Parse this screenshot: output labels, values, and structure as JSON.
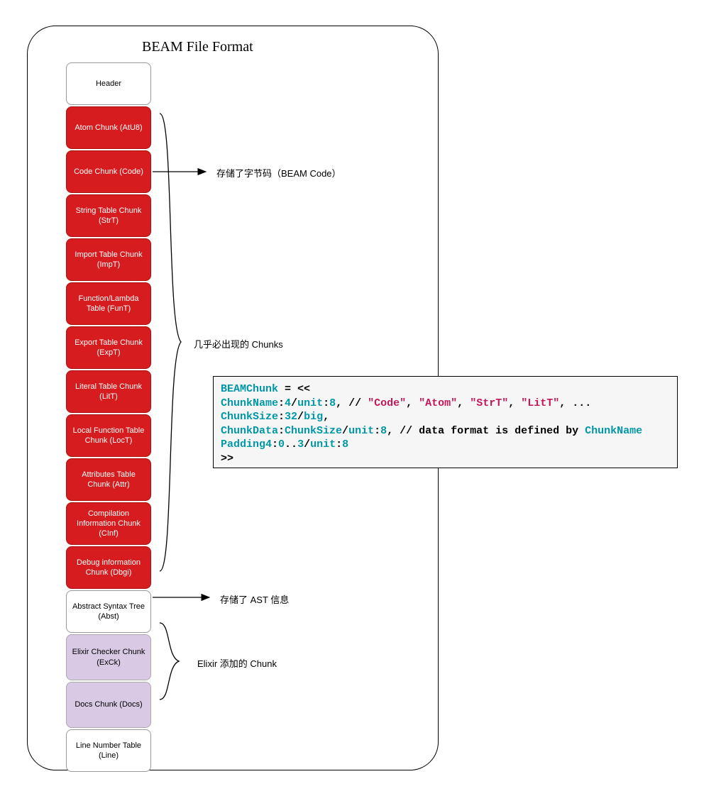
{
  "title": "BEAM File Format",
  "chunks": [
    {
      "label": "Header",
      "style": "white"
    },
    {
      "label": "Atom Chunk (AtU8)",
      "style": "red"
    },
    {
      "label": "Code Chunk (Code)",
      "style": "red"
    },
    {
      "label": "String Table Chunk (StrT)",
      "style": "red"
    },
    {
      "label": "Import Table Chunk (ImpT)",
      "style": "red"
    },
    {
      "label": "Function/Lambda Table (FunT)",
      "style": "red"
    },
    {
      "label": "Export Table Chunk (ExpT)",
      "style": "red"
    },
    {
      "label": "Literal Table Chunk (LitT)",
      "style": "red"
    },
    {
      "label": "Local Function Table Chunk (LocT)",
      "style": "red"
    },
    {
      "label": "Attributes Table Chunk (Attr)",
      "style": "red"
    },
    {
      "label": "Compilation Information Chunk (CInf)",
      "style": "red"
    },
    {
      "label": "Debug information Chunk (Dbgi)",
      "style": "red"
    },
    {
      "label": "Abstract Syntax Tree (Abst)",
      "style": "white2"
    },
    {
      "label": "Elixir Checker Chunk (ExCk)",
      "style": "purple"
    },
    {
      "label": "Docs Chunk (Docs)",
      "style": "purple"
    },
    {
      "label": "Line Number Table (Line)",
      "style": "white2"
    }
  ],
  "annotations": {
    "code": "存储了字节码（BEAM Code）",
    "often": "几乎必出现的 Chunks",
    "abst": "存储了 AST 信息",
    "elixir": "Elixir 添加的 Chunk"
  },
  "code": {
    "l1_a": "BEAMChunk",
    "l1_b": " = <<",
    "l2_a": "ChunkName",
    "l2_b": ":",
    "l2_c": "4",
    "l2_d": "/",
    "l2_e": "unit",
    "l2_f": ":",
    "l2_g": "8",
    "l2_h": ", // ",
    "l2_s1": "\"Code\"",
    "l2_s2": "\"Atom\"",
    "l2_s3": "\"StrT\"",
    "l2_s4": "\"LitT\"",
    "l2_end": ", ...",
    "l3_a": "ChunkSize",
    "l3_b": ":",
    "l3_c": "32",
    "l3_d": "/",
    "l3_e": "big",
    "l3_f": ",",
    "l4_a": "ChunkData",
    "l4_b": ":",
    "l4_c": "ChunkSize",
    "l4_d": "/",
    "l4_e": "unit",
    "l4_f": ":",
    "l4_g": "8",
    "l4_h": ", // data format is defined by ",
    "l4_i": "ChunkName",
    "l5_a": "Padding4",
    "l5_b": ":",
    "l5_c": "0",
    "l5_d": "..",
    "l5_e": "3",
    "l5_f": "/",
    "l5_g": "unit",
    "l5_h": ":",
    "l5_i": "8",
    "l6": ">>"
  }
}
